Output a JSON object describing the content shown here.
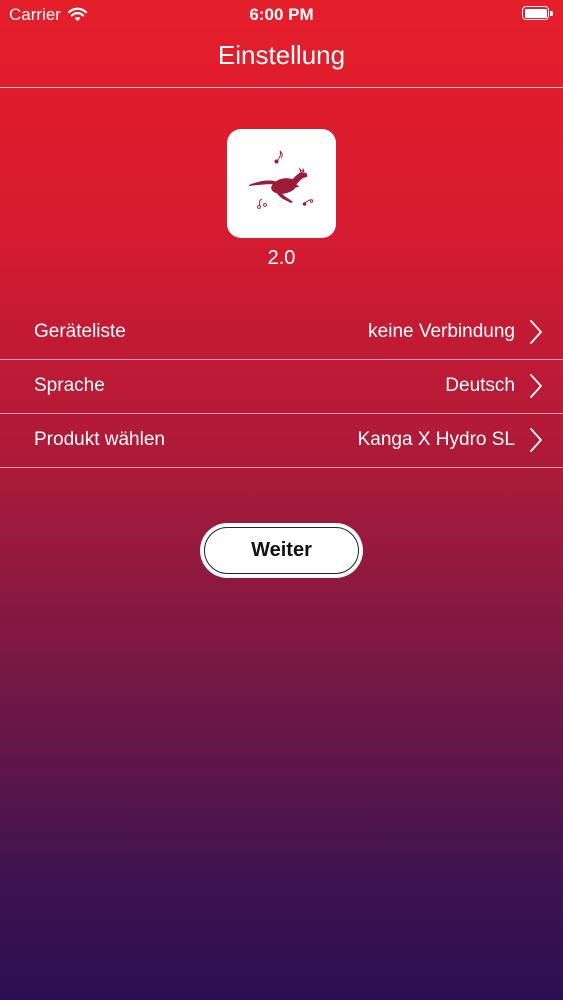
{
  "status_bar": {
    "carrier": "Carrier",
    "time": "6:00 PM",
    "icons": [
      "wifi-icon",
      "battery-icon"
    ]
  },
  "nav": {
    "title": "Einstellung"
  },
  "app": {
    "icon": "kangaroo-logo-icon",
    "version": "2.0",
    "logo_color": "#9c1b36"
  },
  "settings": {
    "rows": [
      {
        "label": "Geräteliste",
        "value": "keine Verbindung"
      },
      {
        "label": "Sprache",
        "value": "Deutsch"
      },
      {
        "label": "Produkt wählen",
        "value": "Kanga X Hydro SL"
      }
    ]
  },
  "actions": {
    "continue_label": "Weiter"
  },
  "colors": {
    "gradient_top": "#e51e2b",
    "gradient_bottom": "#2b0f52",
    "text": "#ffffff"
  }
}
